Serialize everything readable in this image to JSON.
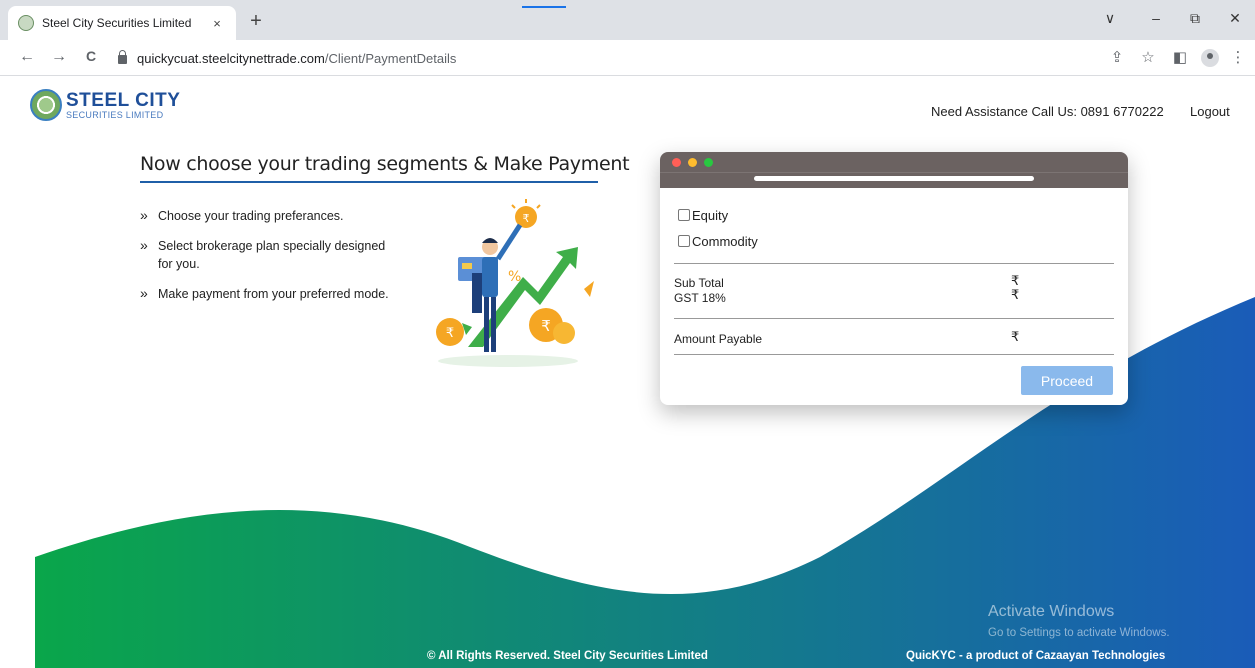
{
  "browser": {
    "tab_title": "Steel City Securities Limited",
    "tab_close": "×",
    "new_tab": "+",
    "url_host": "quickycuat.steelcitynettrade.com",
    "url_path": "/Client/PaymentDetails",
    "back_icon": "←",
    "forward_icon": "→",
    "reload_icon": "C",
    "share_icon": "⇪",
    "star_icon": "☆",
    "panel_icon": "◧",
    "menu_icon": "⋮",
    "minimize_icon": "–",
    "restore_icon": "⧉",
    "close_icon": "✕",
    "dropdown_icon": "∨"
  },
  "header": {
    "logo_name": "STEEL CITY",
    "logo_sub": "SECURITIES LIMITED",
    "assistance": "Need Assistance Call Us: 0891 6770222",
    "logout": "Logout"
  },
  "main": {
    "heading": "Now choose your trading segments & Make Payment",
    "bullets": [
      "Choose your trading preferances.",
      "Select brokerage plan specially designed for you.",
      "Make payment from your preferred mode."
    ],
    "bullet_marker": "»"
  },
  "card": {
    "segments": [
      "Equity",
      "Commodity"
    ],
    "sub_total_label": "Sub Total",
    "gst_label": "GST 18%",
    "amount_payable_label": "Amount Payable",
    "currency_symbol": "₹",
    "proceed_label": "Proceed",
    "dot_colors": [
      "#ff5f57",
      "#febc2e",
      "#28c840"
    ]
  },
  "footer": {
    "copyright": "© All Rights Reserved. Steel City Securities Limited",
    "product": "QuicKYC - a product of Cazaayan Technologies",
    "activate_title": "Activate Windows",
    "activate_sub": "Go to Settings to activate Windows."
  },
  "colors": {
    "accent": "#1f5fa8",
    "wave_green": "#0aa64a",
    "wave_blue": "#1a5cb8",
    "button": "#8ab9ec"
  }
}
